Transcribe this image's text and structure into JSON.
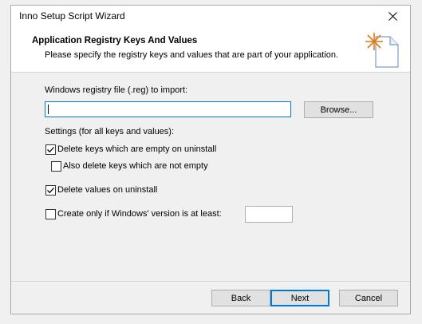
{
  "window": {
    "title": "Inno Setup Script Wizard"
  },
  "header": {
    "title": "Application Registry Keys And Values",
    "subtitle": "Please specify the registry keys and values that are part of your application."
  },
  "regfile": {
    "label": "Windows registry file (.reg) to import:",
    "value": "",
    "browse_label": "Browse..."
  },
  "settings": {
    "label": "Settings (for all keys and values):",
    "delete_keys": {
      "label": "Delete keys which are empty on uninstall",
      "checked": true
    },
    "also_delete": {
      "label": "Also delete keys which are not empty",
      "checked": false
    },
    "delete_values": {
      "label": "Delete values on uninstall",
      "checked": true
    },
    "create_only": {
      "label": "Create only if Windows' version is at least:",
      "checked": false,
      "version_value": ""
    }
  },
  "footer": {
    "back_label": "Back",
    "next_label": "Next",
    "cancel_label": "Cancel"
  },
  "colors": {
    "accent": "#0078d7",
    "wizard_icon": "#e07a10"
  }
}
